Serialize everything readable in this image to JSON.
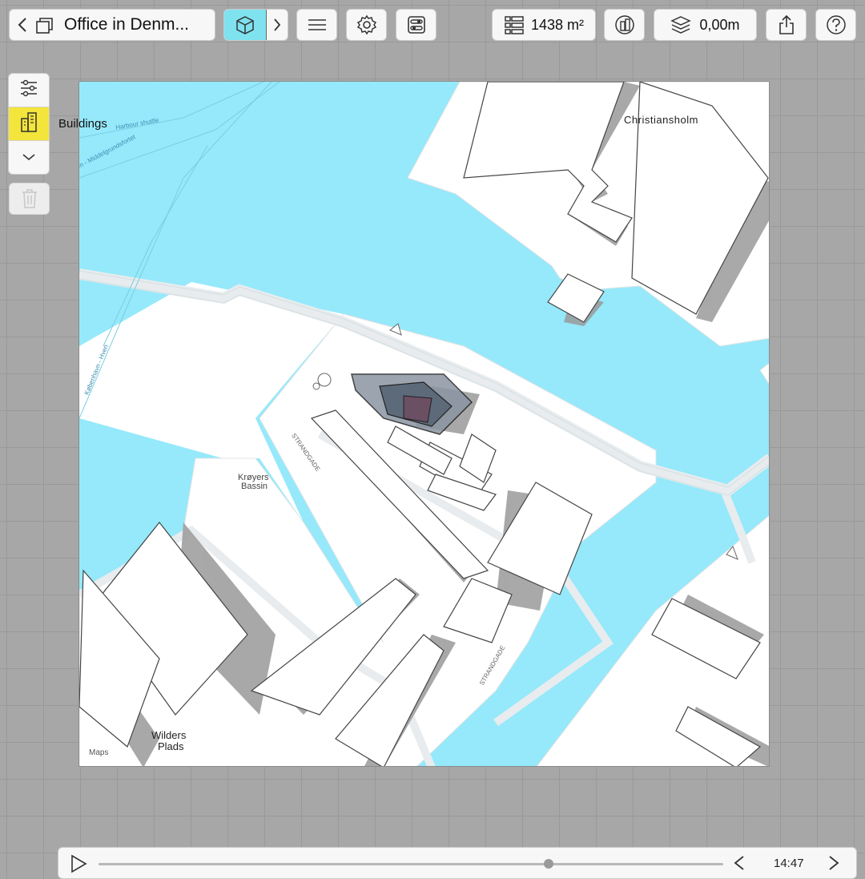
{
  "toolbar": {
    "back_icon": "chevron-left-icon",
    "project_icon": "documents-icon",
    "project_title": "Office in Denm...",
    "view_3d_icon": "cube-3d-icon",
    "next_icon": "chevron-right-icon",
    "menu_icon": "hamburger-menu-icon",
    "settings_icon": "gear-icon",
    "toggles_icon": "toggles-icon",
    "area_icon": "list-rows-icon",
    "area_value": "1438 m²",
    "floor_icon": "building-plan-icon",
    "elevation_icon": "layers-icon",
    "elevation_value": "0,00m",
    "share_icon": "share-icon",
    "help_icon": "question-circle-icon"
  },
  "left_panel": {
    "filter_icon": "sliders-icon",
    "layer_icon": "buildings-icon",
    "layer_label": "Buildings",
    "expand_icon": "chevron-down-icon",
    "delete_icon": "trash-icon"
  },
  "map": {
    "labels": {
      "christiansholm": "Christiansholm",
      "krøyers_bassin_1": "Krøyers",
      "krøyers_bassin_2": "Bassin",
      "wilders_plads_1": "Wilders",
      "wilders_plads_2": "Plads",
      "strandgade_1": "STRANDGADE",
      "strandgade_2": "STRANDGADE",
      "harbour_shuttle": "Harbour shuttle",
      "middelgrundsfortet": "havn - Middelgrundsfortet",
      "kobenhavn_hven": "København - Hven",
      "attribution": "Maps"
    },
    "colors": {
      "water": "#95e9fb",
      "land": "#ffffff",
      "building_shadow": "#9a9a9a",
      "selected": "#5d6a7a"
    }
  },
  "timeline": {
    "play_icon": "play-icon",
    "prev_icon": "chevron-left-icon",
    "next_icon": "chevron-right-icon",
    "time": "14:47",
    "position": 0.72
  }
}
